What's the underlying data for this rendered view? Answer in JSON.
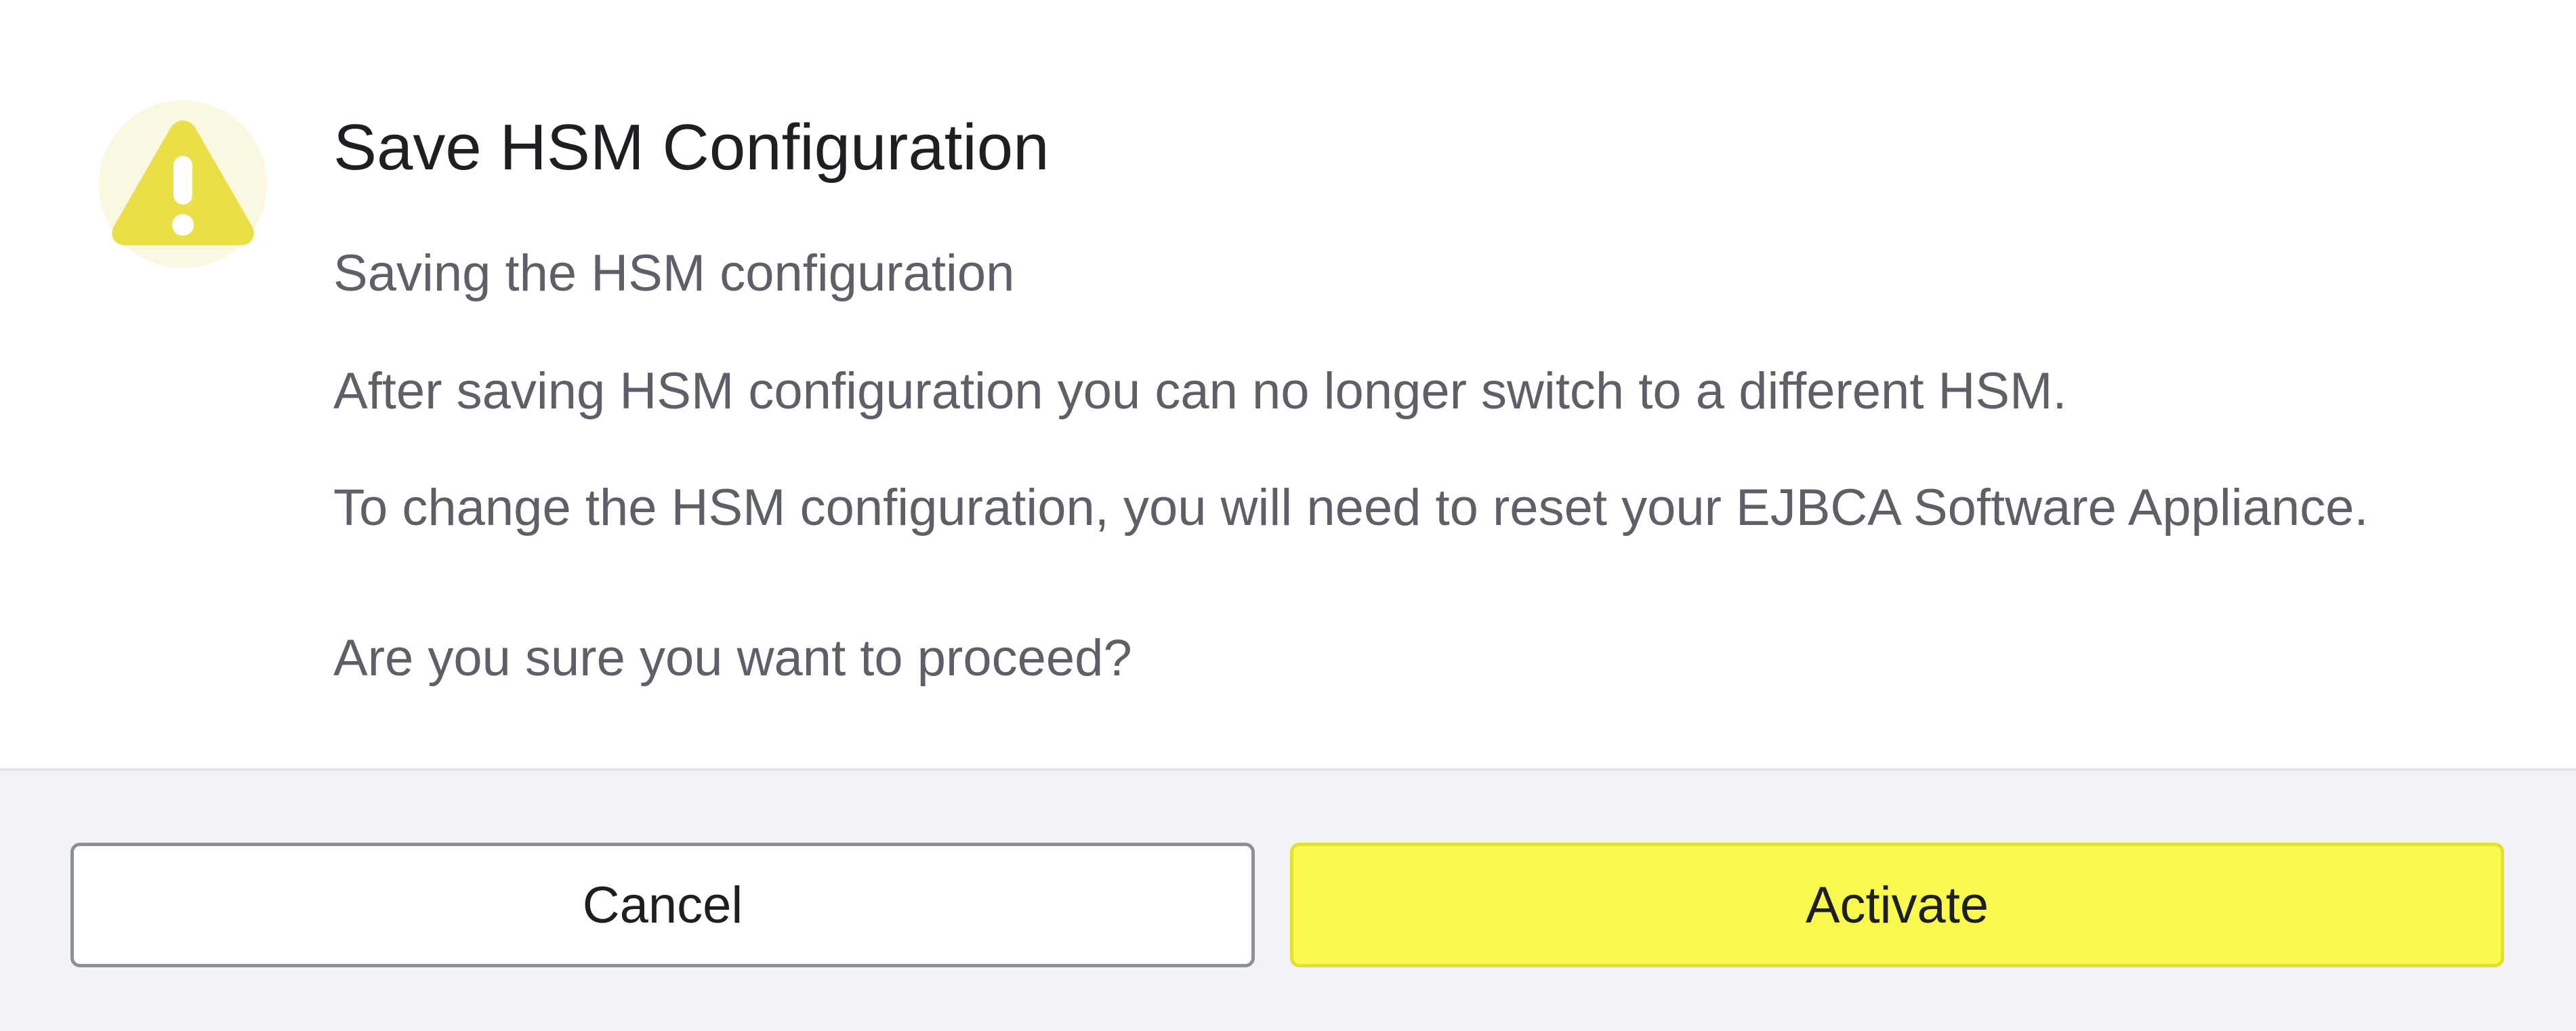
{
  "dialog": {
    "title": "Save HSM Configuration",
    "icon": "warning-icon",
    "subtitle": "Saving the HSM configuration",
    "message_1": "After saving HSM configuration you can no longer switch to a different HSM.",
    "message_2": "To change the HSM configuration, you will need to reset your EJBCA Software Appliance.",
    "question": "Are you sure you want to proceed?"
  },
  "buttons": {
    "cancel_label": "Cancel",
    "activate_label": "Activate"
  },
  "colors": {
    "warning_icon": "#ebdf48",
    "warning_icon_bg": "#fbf8e2",
    "activate_bg": "#fafa4e",
    "footer_bg": "#f2f3f6"
  }
}
